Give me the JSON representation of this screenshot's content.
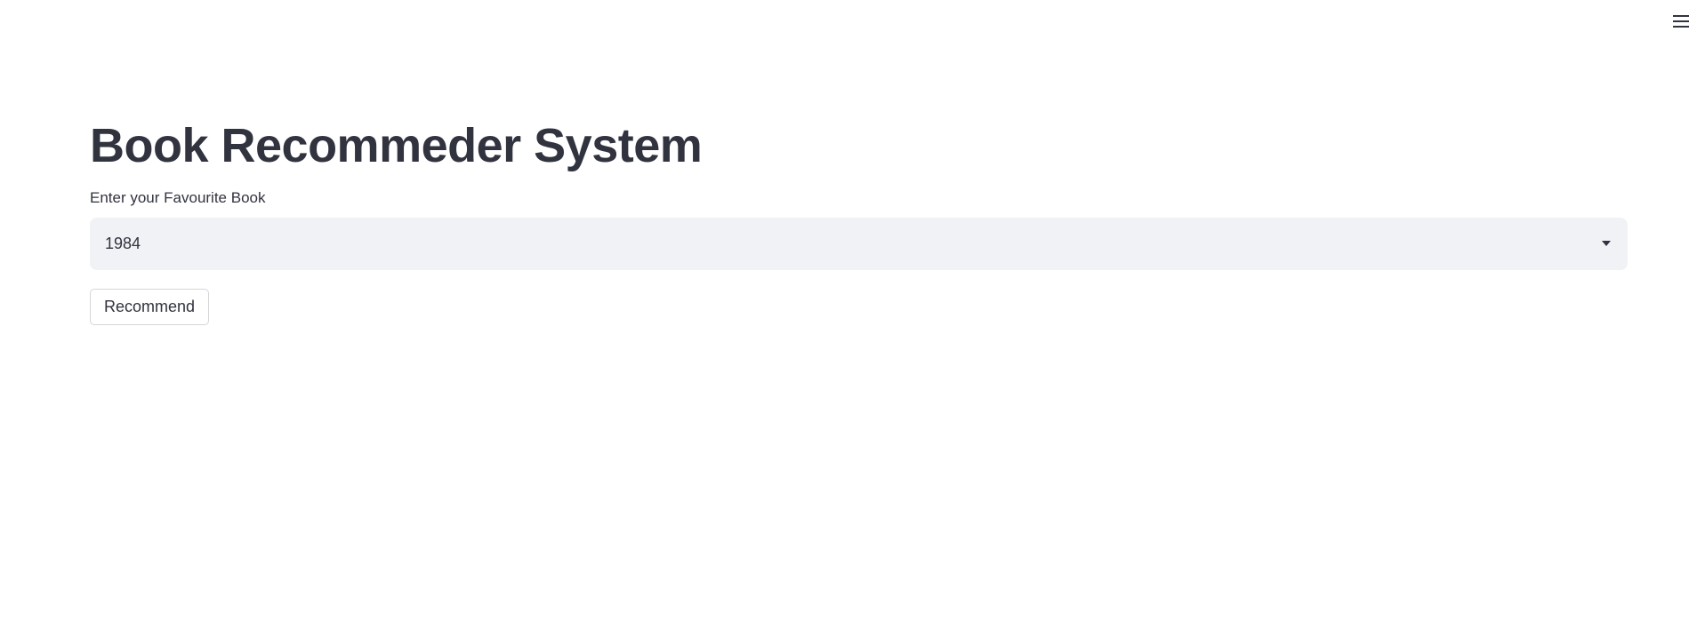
{
  "header": {
    "menu_icon": "hamburger-menu-icon"
  },
  "main": {
    "title": "Book Recommeder System",
    "select": {
      "label": "Enter your Favourite Book",
      "value": "1984",
      "icon": "chevron-down-icon"
    },
    "recommend_label": "Recommend"
  },
  "colors": {
    "text": "#31333f",
    "select_bg": "#f0f2f6",
    "background": "#ffffff"
  }
}
